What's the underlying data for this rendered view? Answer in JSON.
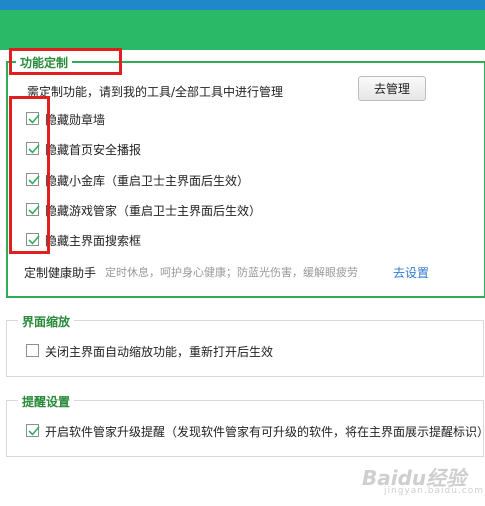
{
  "sections": {
    "custom": {
      "legend": "功能定制",
      "hint": "需定制功能，请到我的工具/全部工具中进行管理",
      "manage_button": "去管理",
      "options": [
        {
          "label": "隐藏勋章墙",
          "checked": true
        },
        {
          "label": "隐藏首页安全播报",
          "checked": true
        },
        {
          "label": "隐藏小金库（重启卫士主界面后生效）",
          "checked": true
        },
        {
          "label": "隐藏游戏管家（重启卫士主界面后生效）",
          "checked": true
        },
        {
          "label": "隐藏主界面搜索框",
          "checked": true
        }
      ],
      "health_label": "定制健康助手",
      "health_desc": "定时休息，呵护身心健康；防蓝光伤害，缓解眼疲劳",
      "health_link": "去设置"
    },
    "zoom": {
      "legend": "界面缩放",
      "option": {
        "label": "关闭主界面自动缩放功能，重新打开后生效",
        "checked": false
      }
    },
    "reminder": {
      "legend": "提醒设置",
      "option": {
        "label": "开启软件管家升级提醒（发现软件管家有可升级的软件，将在主界面展示提醒标识）",
        "checked": true
      }
    }
  },
  "watermark": {
    "text": "Baidu经验",
    "sub": "jingyan.baidu.com"
  },
  "colors": {
    "header_blue": "#1e88c8",
    "header_green": "#2ab967",
    "accent_green": "#2fae5a",
    "annotation_red": "#e02020",
    "link": "#2d7bd5"
  }
}
